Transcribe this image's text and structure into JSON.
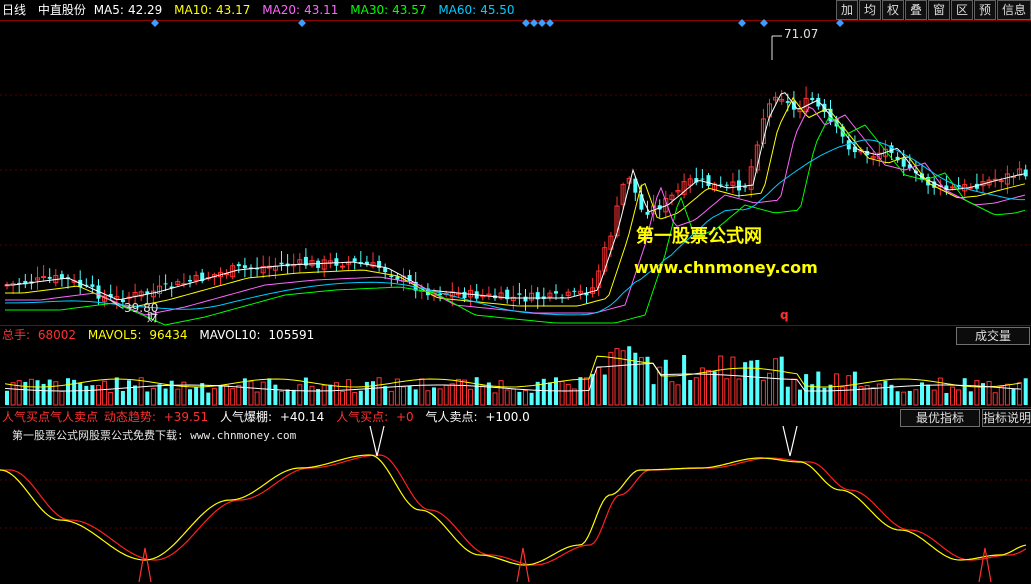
{
  "header": {
    "period": "日线",
    "stock_name": "中直股份",
    "ma": [
      {
        "label": "MA5:",
        "value": "42.29",
        "color": "#ffffff"
      },
      {
        "label": "MA10:",
        "value": "43.17",
        "color": "#ffff00"
      },
      {
        "label": "MA20:",
        "value": "43.11",
        "color": "#ff66ff"
      },
      {
        "label": "MA30:",
        "value": "43.57",
        "color": "#00ff00"
      },
      {
        "label": "MA60:",
        "value": "45.50",
        "color": "#00ccff"
      }
    ]
  },
  "toolbar": [
    "加",
    "均",
    "权",
    "叠",
    "窗",
    "区",
    "预",
    "信息"
  ],
  "price_panel": {
    "high_label": "71.07",
    "low_label": "39.80",
    "cai_marker": "财",
    "q_marker": "q"
  },
  "volume_panel": {
    "total_label": "总手:",
    "total_value": "68002",
    "mavol5_label": "MAVOL5:",
    "mavol5_value": "96434",
    "mavol10_label": "MAVOL10:",
    "mavol10_value": "105591",
    "tab_label": "成交量"
  },
  "indicator_panel": {
    "items": [
      {
        "label": "人气买点气人卖点",
        "value": "",
        "color": "#ff3030"
      },
      {
        "label": "动态趋势:",
        "value": "+39.51",
        "color": "#ff3030"
      },
      {
        "label": "人气爆棚:",
        "value": "+40.14",
        "color": "#ffffff"
      },
      {
        "label": "人气买点:",
        "value": "+0",
        "color": "#ff3030"
      },
      {
        "label": "气人卖点:",
        "value": "+100.0",
        "color": "#ffffff"
      }
    ],
    "tab1": "最优指标",
    "tab2": "指标说明",
    "promo_text": "第一股票公式网股票公式免费下载: www.chnmoney.com"
  },
  "watermark": {
    "line1": "第一股票公式网",
    "line2": "www.chnmoney.com"
  },
  "colors": {
    "up": "#ff3232",
    "down": "#54ffff",
    "ma5": "#ffffff",
    "ma10": "#ffff00",
    "ma20": "#ff66ff",
    "ma30": "#00ff00",
    "ma60": "#00ccff"
  }
}
